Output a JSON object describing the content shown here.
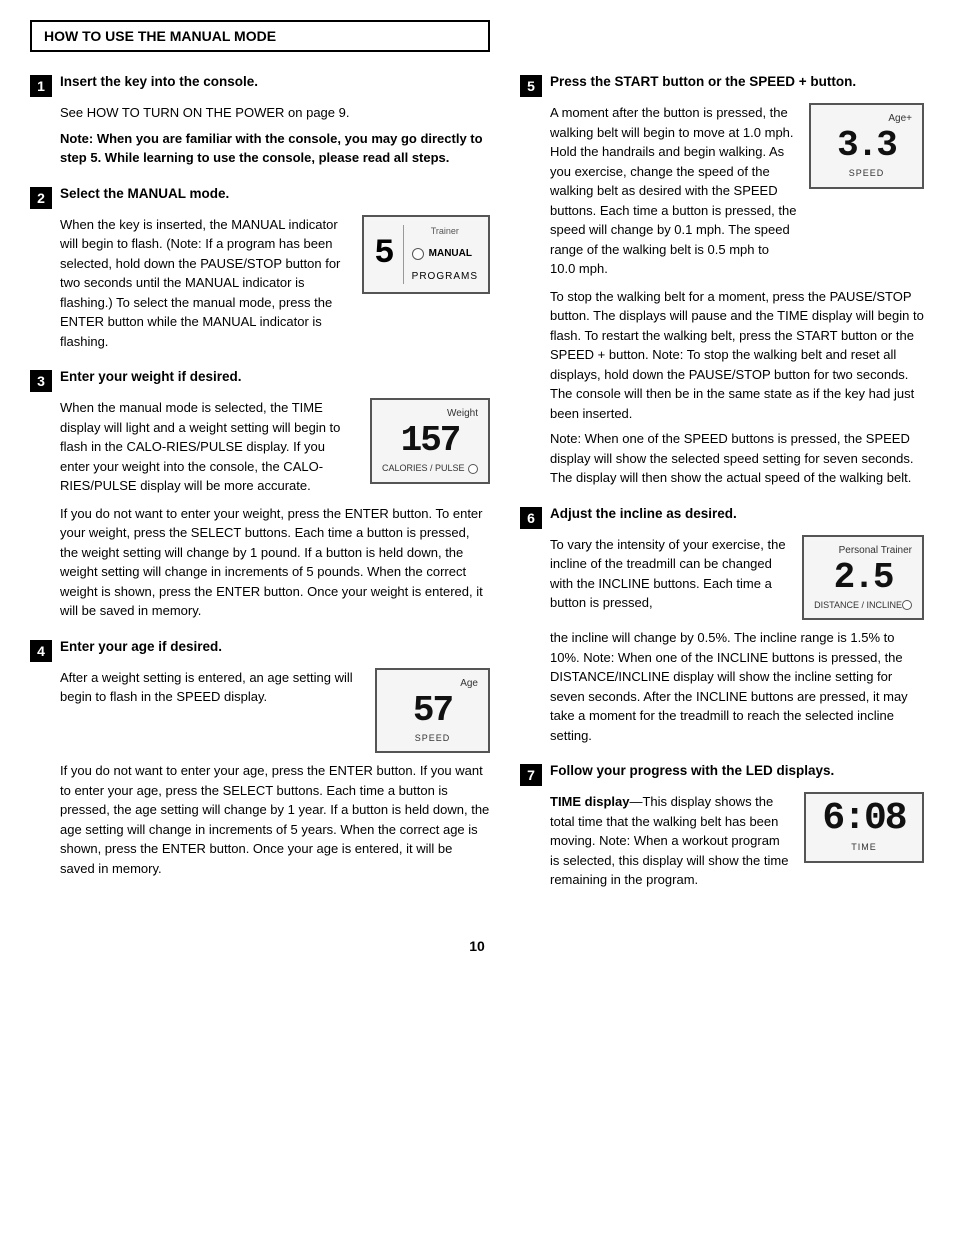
{
  "header": {
    "title": "HOW TO USE THE MANUAL MODE"
  },
  "left_column": {
    "steps": [
      {
        "num": "1",
        "title": "Insert the key into the console.",
        "body": [
          "See HOW TO TURN ON THE POWER on page 9.",
          "Note: When you are familiar with the console, you may go directly to step 5. While learning to use the console, please read all steps."
        ],
        "body_bold_index": 1
      },
      {
        "num": "2",
        "title": "Select the MANUAL mode.",
        "body_intro": "When the key is inserted, the MANUAL indicator will begin to flash. (Note: If a program has been selected, hold down the PAUSE/STOP button for two seconds until the MANUAL indicator is flashing.) To select the manual mode, press the ENTER button while the MANUAL indicator is flashing.",
        "display": {
          "digit": "5",
          "trainer_label": "Trainer",
          "manual_label": "MANUAL",
          "programs_label": "PROGRAMS"
        }
      },
      {
        "num": "3",
        "title": "Enter your weight if desired.",
        "body_intro": "When the manual mode is selected, the TIME display will light and a weight setting will begin to flash in the CALORIES/PULSE display. If you enter your weight into the console, the CALORIES/PULSE display will be more accurate.",
        "body_extra": "If you do not want to enter your weight, press the ENTER button. To enter your weight, press the SELECT buttons. Each time a button is pressed, the weight setting will change by 1 pound. If a button is held down, the weight setting will change in increments of 5 pounds. When the correct weight is shown, press the ENTER button. Once your weight is entered, it will be saved in memory.",
        "display": {
          "label_top": "Weight",
          "digit": "157",
          "label_bottom": "CALORIES / PULSE",
          "has_dot": true
        }
      },
      {
        "num": "4",
        "title": "Enter your age if desired.",
        "body_intro": "After a weight setting is entered, an age setting will begin to flash in the SPEED display.",
        "body_extra": "If you do not want to enter your age, press the ENTER button. If you want to enter your age, press the SELECT buttons. Each time a button is pressed, the age setting will change by 1 year. If a button is held down, the age setting will change in increments of 5 years. When the correct age is shown, press the ENTER button. Once your age is entered, it will be saved in memory.",
        "display": {
          "label_top": "Age",
          "digit": "57",
          "label_bottom": "SPEED"
        }
      }
    ]
  },
  "right_column": {
    "steps": [
      {
        "num": "5",
        "title": "Press the START button or the SPEED + button.",
        "body": "A moment after the button is pressed, the walking belt will begin to move at 1.0 mph. Hold the handrails and begin walking. As you exercise, change the speed of the walking belt as desired with the SPEED buttons. Each time a button is pressed, the speed will change by 0.1 mph. The speed range of the walking belt is 0.5 mph to 10.0 mph.",
        "body2": "To stop the walking belt for a moment, press the PAUSE/STOP button. The displays will pause and the TIME display will begin to flash. To restart the walking belt, press the START button or the SPEED + button. Note: To stop the walking belt and reset all displays, hold down the PAUSE/STOP button for two seconds. The console will then be in the same state as if the key had just been inserted.",
        "body3": "Note: When one of the SPEED buttons is pressed, the SPEED display will show the selected speed setting for seven seconds. The display will then show the actual speed of the walking belt.",
        "display": {
          "label_top": "Age+",
          "digit": "3.3",
          "label_bottom": "SPEED"
        }
      },
      {
        "num": "6",
        "title": "Adjust the incline as desired.",
        "body": "To vary the intensity of your exercise, the incline of the treadmill can be changed with the INCLINE buttons. Each time a button is pressed, the incline will change by 0.5%. The incline range is 1.5% to 10%. Note: When one of the INCLINE buttons is pressed, the DISTANCE/INCLINE display will show the incline setting for seven seconds. After the INCLINE buttons are pressed, it may take a moment for the treadmill to reach the selected incline setting.",
        "display": {
          "label_top": "Personal Trainer",
          "digit": "2.5",
          "label_bottom_left": "DISTANCE / INCLINE",
          "has_dot": true
        }
      },
      {
        "num": "7",
        "title": "Follow your progress with the LED displays.",
        "body": "TIME display—This display shows the total time that the walking belt has been moving. Note: When a workout program is selected, this display will show the time remaining in the program.",
        "display": {
          "digit": "6:08",
          "label_bottom": "TIME"
        }
      }
    ]
  },
  "page_number": "10"
}
